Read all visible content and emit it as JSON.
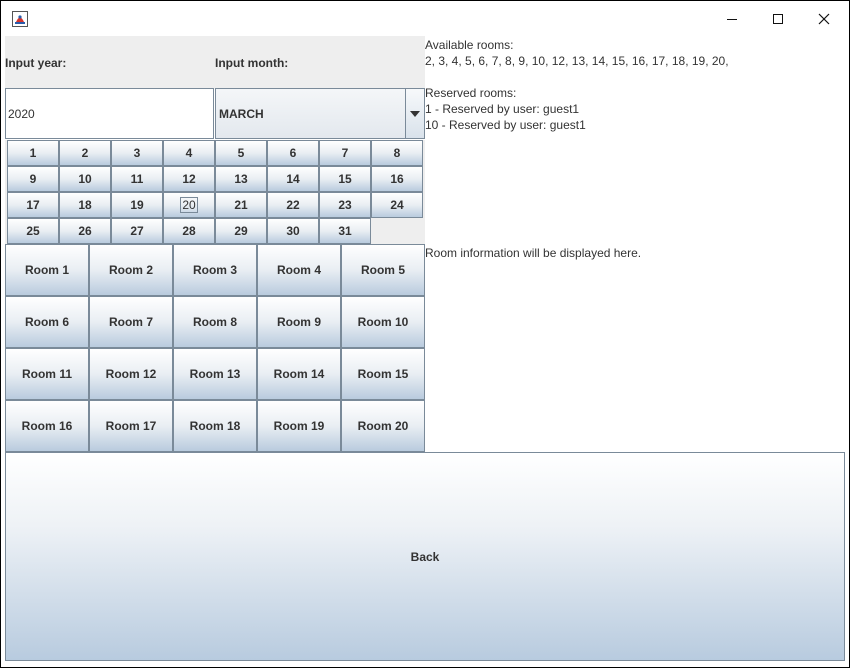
{
  "window": {
    "controls": [
      "minimize",
      "maximize",
      "close"
    ]
  },
  "form": {
    "year_label": "Input year:",
    "month_label": "Input month:",
    "year_value": "2020",
    "month_value": "MARCH"
  },
  "calendar": {
    "days": [
      "1",
      "2",
      "3",
      "4",
      "5",
      "6",
      "7",
      "8",
      "9",
      "10",
      "11",
      "12",
      "13",
      "14",
      "15",
      "16",
      "17",
      "18",
      "19",
      "20",
      "21",
      "22",
      "23",
      "24",
      "25",
      "26",
      "27",
      "28",
      "29",
      "30",
      "31"
    ],
    "selected_day": "20"
  },
  "rooms": [
    "Room 1",
    "Room 2",
    "Room 3",
    "Room 4",
    "Room 5",
    "Room 6",
    "Room 7",
    "Room 8",
    "Room 9",
    "Room 10",
    "Room 11",
    "Room 12",
    "Room 13",
    "Room 14",
    "Room 15",
    "Room 16",
    "Room 17",
    "Room 18",
    "Room 19",
    "Room 20"
  ],
  "info": {
    "available_title": "Available rooms:",
    "available_list": "2, 3, 4, 5, 6, 7, 8, 9, 10, 12, 13, 14, 15, 16, 17, 18, 19, 20,",
    "reserved_title": "Reserved rooms:",
    "reserved_items": [
      "1 - Reserved by user: guest1",
      "10 - Reserved by user: guest1"
    ],
    "room_info": "Room information will be displayed here."
  },
  "back_label": "Back"
}
